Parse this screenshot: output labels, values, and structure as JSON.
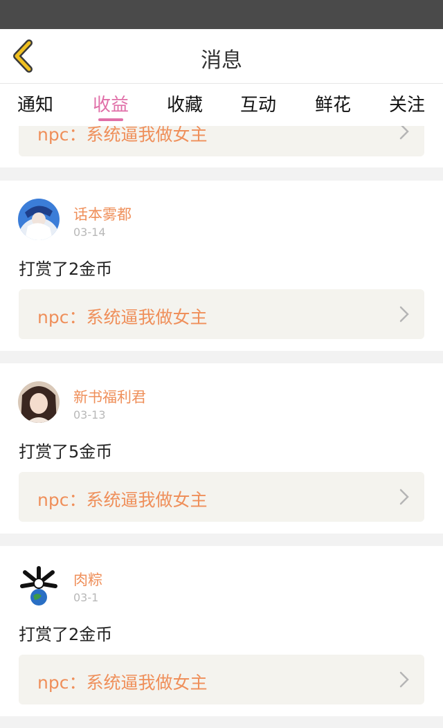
{
  "status_bar": {
    "left": "",
    "right": ""
  },
  "header": {
    "title": "消息"
  },
  "tabs": [
    "通知",
    "收益",
    "收藏",
    "互动",
    "鲜花",
    "关注"
  ],
  "active_tab": "收益",
  "messages": [
    {
      "username": "",
      "date": "",
      "action": "",
      "book": "npc：系统逼我做女主"
    },
    {
      "username": "话本雾都",
      "date": "03-14",
      "action": "打赏了2金币",
      "book": "npc：系统逼我做女主"
    },
    {
      "username": "新书福利君",
      "date": "03-13",
      "action": "打赏了5金币",
      "book": "npc：系统逼我做女主"
    },
    {
      "username": "肉粽",
      "date": "03-1",
      "action": "打赏了2金币",
      "book": "npc：系统逼我做女主"
    }
  ],
  "colors": {
    "accent": "#e06fa8",
    "username": "#ef8f5a",
    "book_bg": "#f4f3ee",
    "back_icon": "#f0c020"
  }
}
